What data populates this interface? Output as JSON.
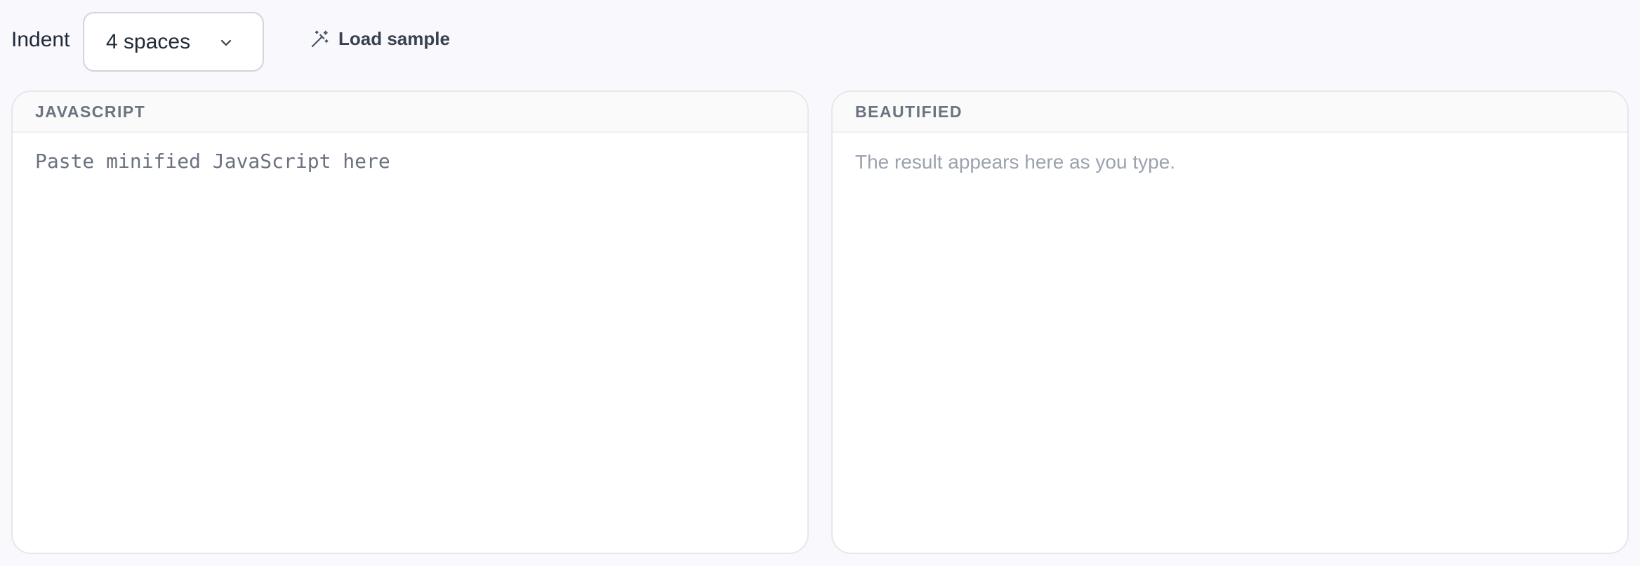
{
  "toolbar": {
    "indent_label": "Indent",
    "indent_select": {
      "selected": "4 spaces"
    },
    "load_sample_label": "Load sample"
  },
  "input_panel": {
    "header": "JAVASCRIPT",
    "value": "",
    "placeholder": "Paste minified JavaScript here"
  },
  "output_panel": {
    "header": "BEAUTIFIED",
    "placeholder": "The result appears here as you type."
  },
  "icons": {
    "select_chevron": "chevron-down-icon",
    "load_sample": "magic-wand-icon"
  }
}
